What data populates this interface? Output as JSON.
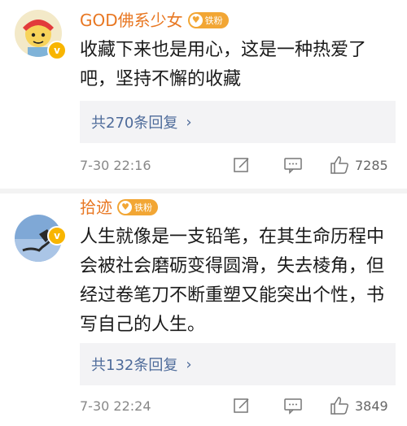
{
  "comments": [
    {
      "username": "GOD佛系少女",
      "fan_badge": "铁粉",
      "text": "收藏下来也是用心，这是一种热爱了吧，坚持不懈的收藏",
      "replies": "共270条回复",
      "time": "7-30 22:16",
      "likes": "7285"
    },
    {
      "username": "拾迹",
      "fan_badge": "铁粉",
      "text": "人生就像是一支铅笔，在其生命历程中会被社会磨砺变得圆滑，失去棱角，但经过卷笔刀不断重塑又能突出个性，书写自己的人生。",
      "replies": "共132条回复",
      "time": "7-30 22:24",
      "likes": "3849"
    }
  ],
  "icons": {
    "verified": "verified-badge-icon",
    "fan_heart": "heart-icon",
    "chevron": "chevron-right-icon",
    "share": "share-edit-icon",
    "comment": "comment-icon",
    "like": "thumbs-up-icon"
  },
  "colors": {
    "username": "#e87722",
    "link": "#4e6b9a",
    "badge": "#f2a634"
  }
}
